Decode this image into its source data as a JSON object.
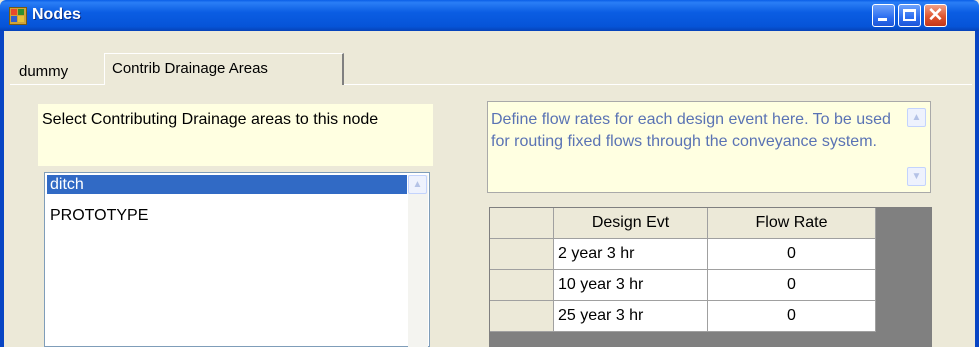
{
  "window": {
    "title": "Nodes"
  },
  "tabs": [
    {
      "label": "dummy",
      "active": false
    },
    {
      "label": "Contrib Drainage Areas",
      "active": true
    }
  ],
  "select_panel": {
    "label": "Select Contributing Drainage areas to this node"
  },
  "drainage_list": {
    "items": [
      {
        "label": "ditch",
        "selected": true
      },
      {
        "label": "PROTOTYPE",
        "selected": false
      }
    ]
  },
  "description": {
    "text": "Define flow rates for each design event here.  To be used for routing fixed flows through the conveyance system."
  },
  "flow_grid": {
    "columns": [
      "Design Evt",
      "Flow Rate"
    ],
    "rows": [
      {
        "event": "2 year 3 hr",
        "flow": "0"
      },
      {
        "event": "10 year 3 hr",
        "flow": "0"
      },
      {
        "event": "25 year 3 hr",
        "flow": "0"
      }
    ]
  },
  "icons": {
    "app": "window-app-icon",
    "minimize": "minimize-icon",
    "maximize": "maximize-icon",
    "close": "close-icon",
    "scroll_up": "scroll-up-arrow-icon",
    "scroll_down": "scroll-down-arrow-icon"
  },
  "colors": {
    "titlebar": "#0654d8",
    "window_bg": "#ece9d8",
    "tooltip_bg": "#ffffe1",
    "selection": "#316ac5",
    "grid_bg": "#808080",
    "description_text": "#5a73b4"
  }
}
